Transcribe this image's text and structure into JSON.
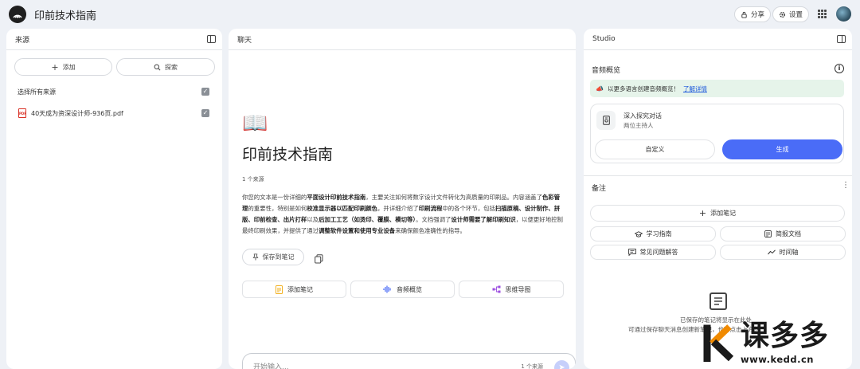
{
  "app": {
    "title": "印前技术指南"
  },
  "topbar": {
    "share_label": "分享",
    "settings_label": "设置"
  },
  "sources": {
    "header": "来源",
    "add_label": "添加",
    "explore_label": "探索",
    "select_all_label": "选择所有来源",
    "items": [
      {
        "name": "40天成为资深设计师-936页.pdf",
        "checked": true
      }
    ]
  },
  "chat": {
    "header": "聊天",
    "emoji": "📖",
    "notebook_title": "印前技术指南",
    "source_count": "1 个来源",
    "summary": [
      {
        "text": "你您的文本是一份详细的",
        "bold": false
      },
      {
        "text": "平面设计印前技术指南",
        "bold": true
      },
      {
        "text": "，主要关注如何将数字设计文件转化为高质量的印刷品。内容涵盖了",
        "bold": false
      },
      {
        "text": "色彩管理",
        "bold": true
      },
      {
        "text": "的重要性，特别是如何",
        "bold": false
      },
      {
        "text": "校准显示器以匹配印刷颜色",
        "bold": true
      },
      {
        "text": "，并详细介绍了",
        "bold": false
      },
      {
        "text": "印刷流程",
        "bold": true
      },
      {
        "text": "中的各个环节，包括",
        "bold": false
      },
      {
        "text": "扫描原稿、设计制作、拼版、印前检查、出片打样",
        "bold": true
      },
      {
        "text": "以及",
        "bold": false
      },
      {
        "text": "后加工工艺（如烫印、覆膜、模切等）",
        "bold": true
      },
      {
        "text": "。文档强调了",
        "bold": false
      },
      {
        "text": "设计师需要了解印刷知识",
        "bold": true
      },
      {
        "text": "，以便更好地控制最终印刷效果，并提供了通过",
        "bold": false
      },
      {
        "text": "调整软件设置和使用专业设备",
        "bold": true
      },
      {
        "text": "来确保颜色准确性的指导。",
        "bold": false
      }
    ],
    "save_note_label": "保存到笔记",
    "actions": [
      {
        "label": "添加笔记",
        "icon": "note-icon"
      },
      {
        "label": "音频概览",
        "icon": "audio-wave-icon"
      },
      {
        "label": "思维导图",
        "icon": "mindmap-icon"
      }
    ],
    "input_placeholder": "开始输入...",
    "input_source_count": "1 个来源"
  },
  "studio": {
    "header": "Studio",
    "audio_title": "音频概览",
    "banner_text": "以更多语言创建音频概览！",
    "banner_link": "了解详情",
    "deep_dive_title": "深入探究对话",
    "deep_dive_sub": "两位主持人",
    "customize_label": "自定义",
    "generate_label": "生成",
    "notes_title": "备注",
    "add_note_label": "添加笔记",
    "quick_buttons": [
      {
        "label": "学习指南",
        "icon": "study-guide-icon"
      },
      {
        "label": "简报文档",
        "icon": "brief-doc-icon"
      },
      {
        "label": "常见问题解答",
        "icon": "faq-icon"
      },
      {
        "label": "时间轴",
        "icon": "timeline-icon"
      }
    ],
    "empty_title": "已保存的笔记将显示在此处",
    "empty_sub": "可通过保存聊天消息创建新笔记，也可点击上方的"
  },
  "watermark": {
    "brand": "课多多",
    "url": "www.kedd.cn"
  },
  "colors": {
    "primary": "#4a6cf7",
    "banner_bg": "#e6f4ea",
    "pdf_red": "#d93025"
  }
}
